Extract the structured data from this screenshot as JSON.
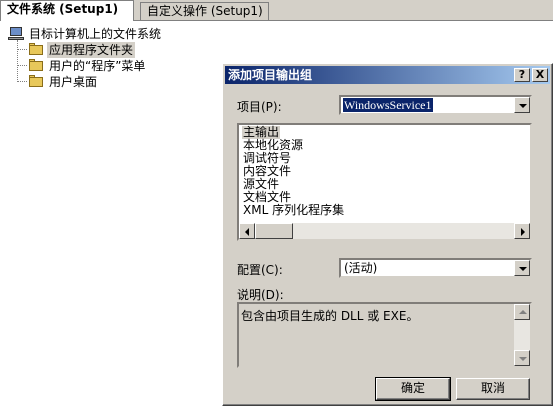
{
  "tabs": [
    {
      "label": "文件系统 (Setup1)",
      "active": true
    },
    {
      "label": "自定义操作 (Setup1)",
      "active": false
    }
  ],
  "tree": {
    "root": "目标计算机上的文件系统",
    "children": [
      "应用程序文件夹",
      "用户的“程序”菜单",
      "用户桌面"
    ],
    "selected_index": 0
  },
  "dialog": {
    "title": "添加项目输出组",
    "help_label": "?",
    "close_label": "X",
    "project_label": "项目(P):",
    "project_value": "WindowsService1",
    "outputs": [
      "主输出",
      "本地化资源",
      "调试符号",
      "内容文件",
      "源文件",
      "文档文件",
      "XML 序列化程序集"
    ],
    "config_label": "配置(C):",
    "config_value": "(活动)",
    "desc_label": "说明(D):",
    "desc_text": "包含由项目生成的 DLL 或 EXE。",
    "ok_label": "确定",
    "cancel_label": "取消"
  },
  "colors": {
    "title_start": "#0a246a",
    "title_end": "#a6caf0",
    "face": "#d4d0c8"
  }
}
